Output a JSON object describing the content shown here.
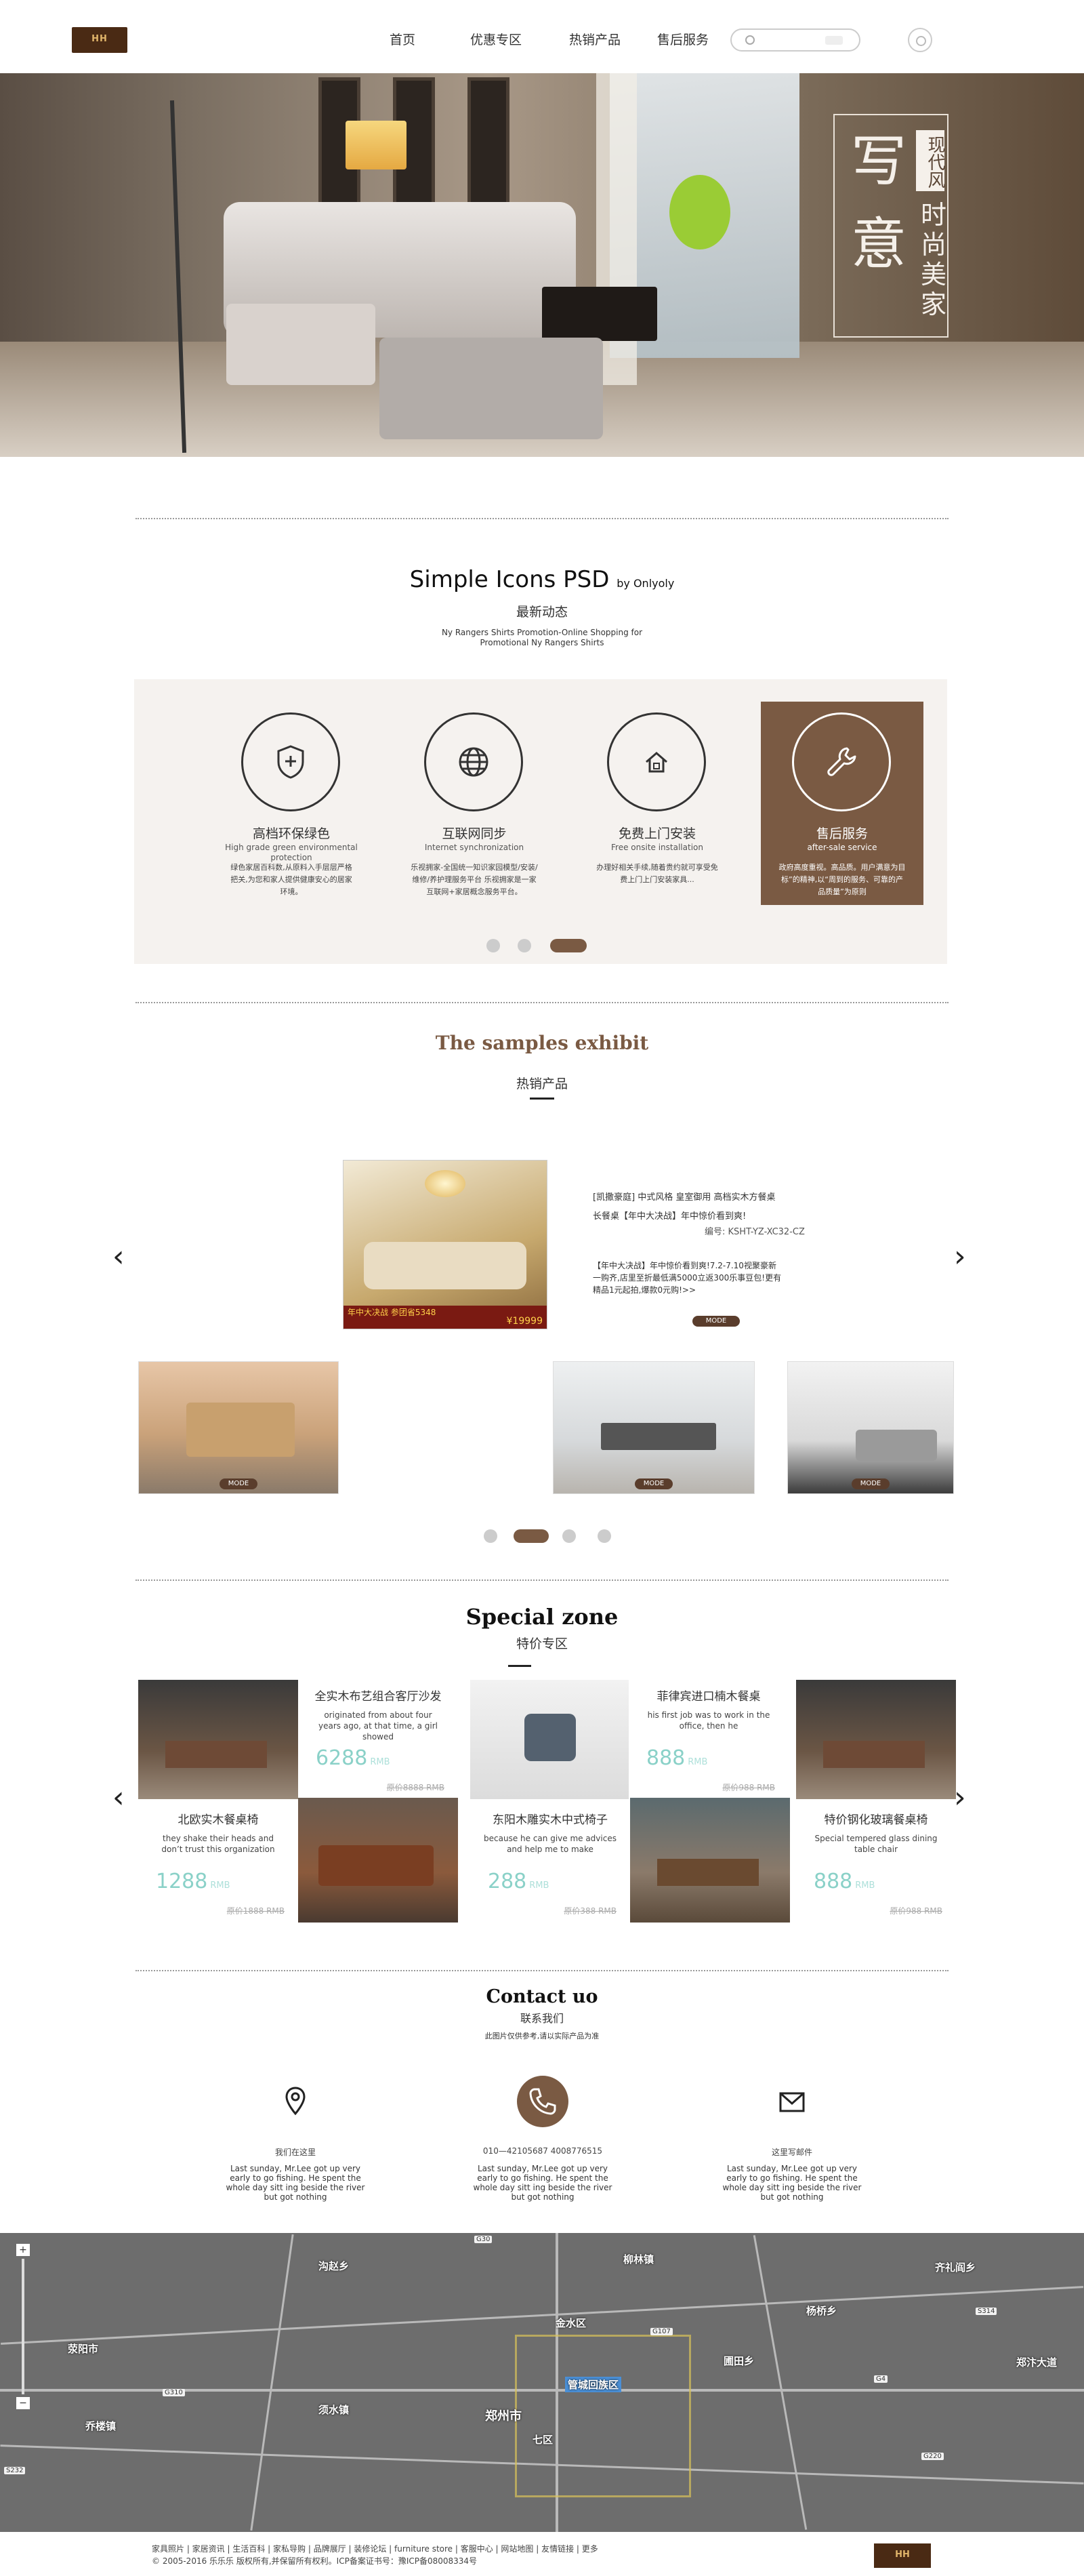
{
  "header": {
    "logo_text": "HH",
    "nav": [
      "首页",
      "优惠专区",
      "热销产品",
      "售后服务"
    ],
    "search_button": "搜索"
  },
  "hero": {
    "big_char_1": "写",
    "big_char_2": "意",
    "tag": "现代风",
    "vert_1": "时",
    "vert_2": "尚",
    "vert_3": "美",
    "vert_4": "家"
  },
  "services": {
    "title": "Simple Icons PSD",
    "title_by": "by Onlyoly",
    "subtitle": "最新动态",
    "desc_1": "Ny Rangers Shirts Promotion-Online Shopping for",
    "desc_2": "Promotional Ny Rangers Shirts",
    "items": [
      {
        "icon": "shield-plus-icon",
        "title": "高档环保绿色",
        "en": "High grade green environmental protection",
        "text": "绿色家居百科数,从原料入手层层严格把关,为您和家人提供健康安心的居家环境。"
      },
      {
        "icon": "globe-icon",
        "title": "互联网同步",
        "en": "Internet synchronization",
        "text": "乐视拥家-全国统一知识家园模型/安装/维修/养护理服务平台 乐视拥家是一家互联网+家居概念服务平台。"
      },
      {
        "icon": "house-icon",
        "title": "免费上门安装",
        "en": "Free onsite installation",
        "text": "办理好相关手续,随着贵约就可享受免费上门上门安装家具..."
      },
      {
        "icon": "wrench-icon",
        "title": "售后服务",
        "en": "after-sale service",
        "text": "政府高度重视。高品质。用户满意为目标”的精神,以“周到的服务、可靠的产品质量”为原则"
      }
    ]
  },
  "samples": {
    "title": "The samples exhibit",
    "subtitle": "热销产品",
    "feature": {
      "line1": "[凯撒豪庭] 中式风格 皇室御用 高档实木方餐桌",
      "line2": "长餐桌【年中大决战】年中惊价看到爽!",
      "code": "编号: KSHT-YZ-XC32-CZ",
      "promo_1": "【年中大决战】年中惊价看到爽!7.2-7.10视聚豪新一购齐,店里至折最低满5000立返300乐事豆包!更有精品1元起拍,爆款0元购!>>",
      "banner_1": "年中大决战 参团省5348",
      "banner_2": "¥19999",
      "mode": "MODE"
    },
    "thumbs": [
      {
        "mode": "MODE"
      },
      {
        "mode": "MODE"
      },
      {
        "mode": "MODE"
      }
    ]
  },
  "special": {
    "title": "Special zone",
    "subtitle": "特价专区",
    "rmb": "RMB",
    "items": [
      {
        "name": "全实木布艺组合客厅沙发",
        "desc": "originated from about four years ago, at that time, a girl showed",
        "price": "6288",
        "old": "原价8888 RMB"
      },
      {
        "name": "菲律宾进口楠木餐桌",
        "desc": "his first job was to work in the office, then he",
        "price": "888",
        "old": "原价988 RMB"
      },
      {
        "name": "北欧实木餐桌椅",
        "desc": "they shake their heads and don’t trust this organization",
        "price": "1288",
        "old": "原价1888 RMB"
      },
      {
        "name": "东阳木雕实木中式椅子",
        "desc": "because he can give me advices and help me to make",
        "price": "288",
        "old": "原价388 RMB"
      },
      {
        "name": "特价钢化玻璃餐桌椅",
        "desc": "Special tempered glass dining table chair",
        "price": "888",
        "old": "原价988 RMB"
      }
    ]
  },
  "contact": {
    "title": "Contact uo",
    "subtitle": "联系我们",
    "note": "此图片仅供参考,请以实际产品为准",
    "items": [
      {
        "icon": "location-pin-icon",
        "label": "我们在这里",
        "text": "Last sunday, Mr.Lee got up very early to go fishing. He spent the whole day sitt ing beside the river but got nothing"
      },
      {
        "icon": "phone-icon",
        "label": "010—42105687    4008776515",
        "text": "Last sunday, Mr.Lee got up very early to go fishing. He spent the whole day sitt ing beside the river but got nothing"
      },
      {
        "icon": "mail-icon",
        "label": "这里写邮件",
        "text": "Last sunday, Mr.Lee got up very early to go fishing. He spent the whole day sitt ing beside the river but got nothing"
      }
    ]
  },
  "map": {
    "labels": [
      "荥阳市",
      "金水区",
      "郑州市",
      "管城回族区",
      "七区",
      "圃田乡",
      "杨桥乡",
      "柳林镇",
      "齐礼阎乡",
      "沟赵乡",
      "须水镇",
      "乔楼镇",
      "郑汴大道"
    ],
    "roads": [
      "G310",
      "G30",
      "G107",
      "G4",
      "G220",
      "S232",
      "S314"
    ]
  },
  "footer": {
    "links": "家具照片 | 家居资讯 | 生活百科 | 家私导购 | 品牌展厅 | 装修论坛 | furniture store | 客服中心 | 网站地图 | 友情链接 | 更多",
    "copyright": "© 2005-2016 乐乐乐 版权所有,并保留所有权利。ICP备案证书号：豫ICP备08008334号",
    "logo_text": "HH"
  }
}
